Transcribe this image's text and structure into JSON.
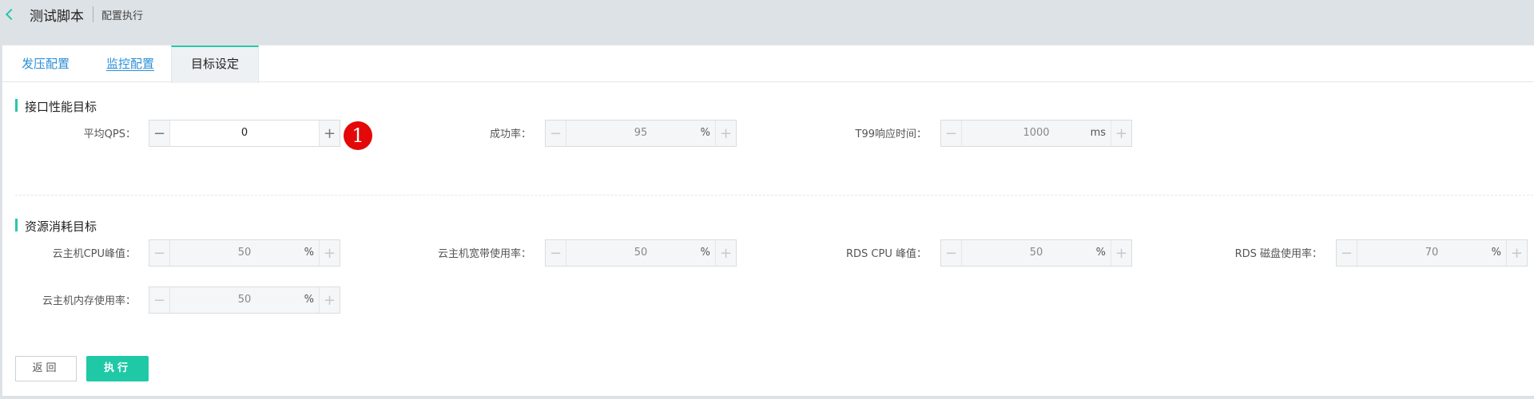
{
  "header": {
    "back_icon": "chevron-left-icon",
    "title": "测试脚本",
    "subtitle": "配置执行"
  },
  "tabs": [
    {
      "label": "发压配置"
    },
    {
      "label": "监控配置"
    },
    {
      "label": "目标设定"
    }
  ],
  "performance": {
    "title": "接口性能目标",
    "fields": [
      {
        "label": "平均QPS：",
        "value": "0",
        "unit": ""
      },
      {
        "label": "成功率：",
        "value": "95",
        "unit": "%"
      },
      {
        "label": "T99响应时间：",
        "value": "1000",
        "unit": "ms"
      }
    ],
    "badge": "1"
  },
  "resources": {
    "title": "资源消耗目标",
    "fields": [
      {
        "label": "云主机CPU峰值：",
        "value": "50",
        "unit": "%"
      },
      {
        "label": "云主机宽带使用率：",
        "value": "50",
        "unit": "%"
      },
      {
        "label": "RDS CPU 峰值：",
        "value": "50",
        "unit": "%"
      },
      {
        "label": "RDS 磁盘使用率：",
        "value": "70",
        "unit": "%"
      },
      {
        "label": "云主机内存使用率：",
        "value": "50",
        "unit": "%"
      }
    ]
  },
  "stepper_buttons": {
    "minus": "−",
    "plus": "+"
  },
  "actions": {
    "back_label": "返回",
    "run_label": "执行"
  },
  "colors": {
    "accent": "#1fc9a6",
    "link": "#2b8fd6",
    "badge": "#e30909"
  }
}
